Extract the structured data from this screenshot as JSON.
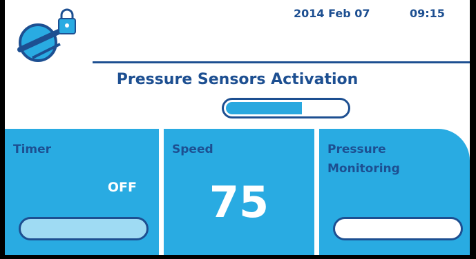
{
  "header": {
    "date": "2014 Feb 07",
    "time": "09:15"
  },
  "activation": {
    "title": "Pressure Sensors Activation",
    "progress_fraction": 0.63
  },
  "panels": {
    "timer": {
      "label": "Timer",
      "value": "OFF"
    },
    "speed": {
      "label": "Speed",
      "value": "75"
    },
    "pressure": {
      "label_line1": "Pressure",
      "label_line2": "Monitoring"
    }
  },
  "colors": {
    "brand_blue": "#1d4f91",
    "panel_blue": "#29abe2",
    "light_blue": "#9fdbf3"
  },
  "icons": {
    "logo": "syringe-pump-icon",
    "lock": "lock-icon"
  }
}
